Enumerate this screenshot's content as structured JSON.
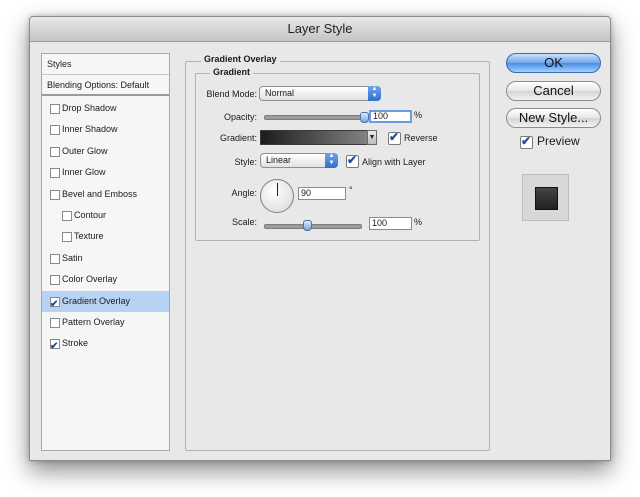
{
  "window": {
    "title": "Layer Style"
  },
  "styles_panel": {
    "header": "Styles",
    "blending_options": "Blending Options: Default",
    "items": [
      {
        "label": "Drop Shadow",
        "checked": false,
        "indent": false,
        "selected": false
      },
      {
        "label": "Inner Shadow",
        "checked": false,
        "indent": false,
        "selected": false
      },
      {
        "label": "Outer Glow",
        "checked": false,
        "indent": false,
        "selected": false
      },
      {
        "label": "Inner Glow",
        "checked": false,
        "indent": false,
        "selected": false
      },
      {
        "label": "Bevel and Emboss",
        "checked": false,
        "indent": false,
        "selected": false
      },
      {
        "label": "Contour",
        "checked": false,
        "indent": true,
        "selected": false
      },
      {
        "label": "Texture",
        "checked": false,
        "indent": true,
        "selected": false
      },
      {
        "label": "Satin",
        "checked": false,
        "indent": false,
        "selected": false
      },
      {
        "label": "Color Overlay",
        "checked": false,
        "indent": false,
        "selected": false
      },
      {
        "label": "Gradient Overlay",
        "checked": true,
        "indent": false,
        "selected": true
      },
      {
        "label": "Pattern Overlay",
        "checked": false,
        "indent": false,
        "selected": false
      },
      {
        "label": "Stroke",
        "checked": true,
        "indent": false,
        "selected": false
      }
    ]
  },
  "gradient_overlay": {
    "section_title": "Gradient Overlay",
    "group_title": "Gradient",
    "blend_mode": {
      "label": "Blend Mode:",
      "value": "Normal"
    },
    "opacity": {
      "label": "Opacity:",
      "value": "100",
      "unit": "%",
      "level": 1.0
    },
    "gradient": {
      "label": "Gradient:",
      "colors": [
        "#1c1c1c",
        "#8a8a8a"
      ]
    },
    "reverse": {
      "label": "Reverse",
      "checked": true
    },
    "style": {
      "label": "Style:",
      "value": "Linear"
    },
    "align_with_layer": {
      "label": "Align with Layer",
      "checked": true
    },
    "angle": {
      "label": "Angle:",
      "value": "90",
      "unit": "°"
    },
    "scale": {
      "label": "Scale:",
      "value": "100",
      "unit": "%",
      "level": 0.42
    }
  },
  "buttons": {
    "ok": "OK",
    "cancel": "Cancel",
    "new_style": "New Style...",
    "preview": {
      "label": "Preview",
      "checked": true
    }
  },
  "colors": {
    "accent": "#4d8de2",
    "selection": "#b7d3f3"
  }
}
